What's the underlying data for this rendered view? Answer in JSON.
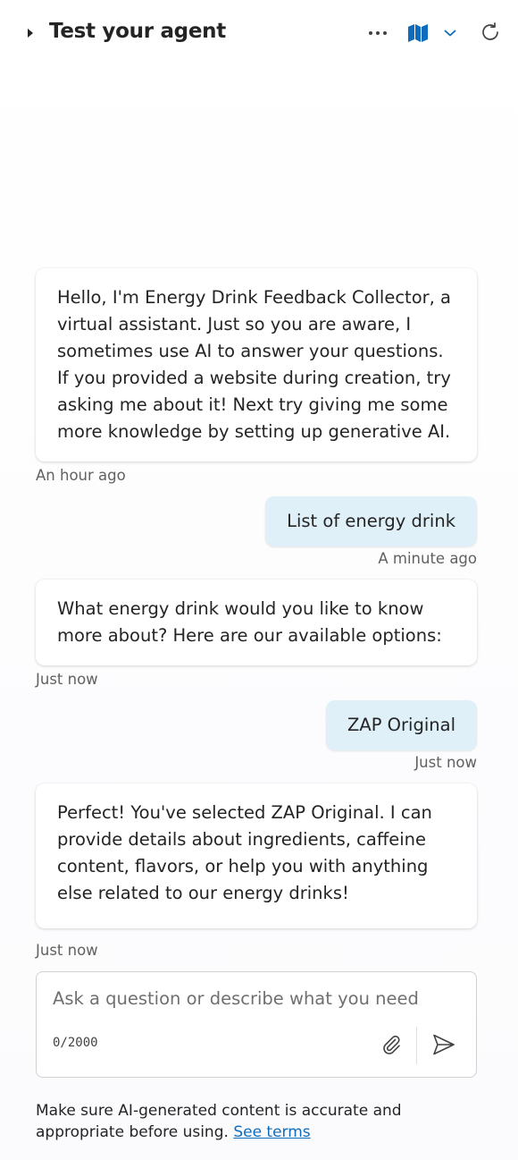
{
  "header": {
    "title": "Test your agent",
    "icons": {
      "collapse": "caret-right-icon",
      "more": "more-horizontal-icon",
      "map": "map-icon",
      "dropdown": "chevron-down-icon",
      "refresh": "refresh-icon"
    }
  },
  "messages": [
    {
      "role": "bot",
      "text": "Hello, I'm Energy Drink Feedback Collector, a virtual assistant. Just so you are aware, I sometimes use AI to answer your questions. If you provided a website during creation, try asking me about it! Next try giving me some more knowledge by setting up generative AI.",
      "timestamp": "An hour ago"
    },
    {
      "role": "user",
      "text": "List of energy drink",
      "timestamp": "A minute ago"
    },
    {
      "role": "bot",
      "text": "What energy drink would you like to know more about? Here are our available options:",
      "timestamp": "Just now"
    },
    {
      "role": "user",
      "text": "ZAP Original",
      "timestamp": "Just now"
    },
    {
      "role": "bot",
      "text": "Perfect! You've selected ZAP Original. I can provide details about ingredients, caffeine content, flavors, or help you with anything else related to our energy drinks!",
      "timestamp": "Just now"
    }
  ],
  "composer": {
    "placeholder": "Ask a question or describe what you need",
    "value": "",
    "counter": "0/2000",
    "icons": {
      "attach": "paperclip-icon",
      "send": "send-icon"
    }
  },
  "footer": {
    "disclaimer": "Make sure AI-generated content is accurate and appropriate before using.",
    "link": "See terms"
  },
  "colors": {
    "accent": "#0f6cbd",
    "user_bubble": "#dff0f9",
    "text": "#242424",
    "muted": "#616161"
  }
}
